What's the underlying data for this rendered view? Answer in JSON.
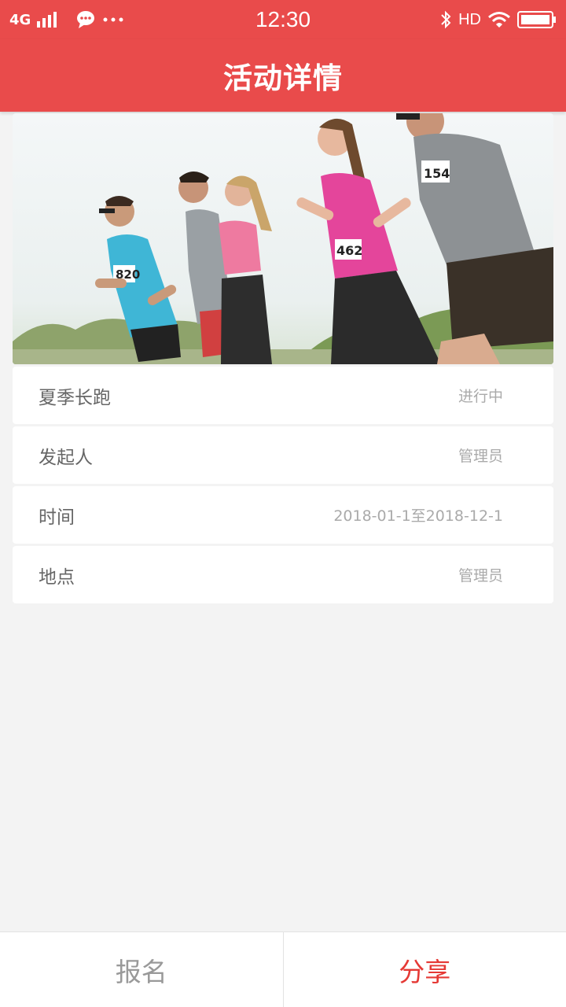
{
  "status_bar": {
    "network": "4G",
    "clock": "12:30",
    "hd": "HD",
    "icons": [
      "signal-icon",
      "chat-bubble-icon",
      "more-dots-icon",
      "bluetooth-icon",
      "wifi-icon",
      "battery-icon"
    ]
  },
  "header": {
    "title": "活动详情"
  },
  "hero": {
    "bibs": [
      "820",
      "462",
      "154"
    ],
    "colors": {
      "sky": "#eef3f4",
      "grass": "#7e9a5a"
    }
  },
  "details": [
    {
      "label": "夏季长跑",
      "value": "进行中"
    },
    {
      "label": "发起人",
      "value": "管理员"
    },
    {
      "label": "时间",
      "value": "2018-01-1至2018-12-1"
    },
    {
      "label": "地点",
      "value": "管理员"
    }
  ],
  "footer": {
    "signup_label": "报名",
    "share_label": "分享"
  },
  "colors": {
    "brand": "#e94b4b",
    "share_accent": "#e53935"
  }
}
